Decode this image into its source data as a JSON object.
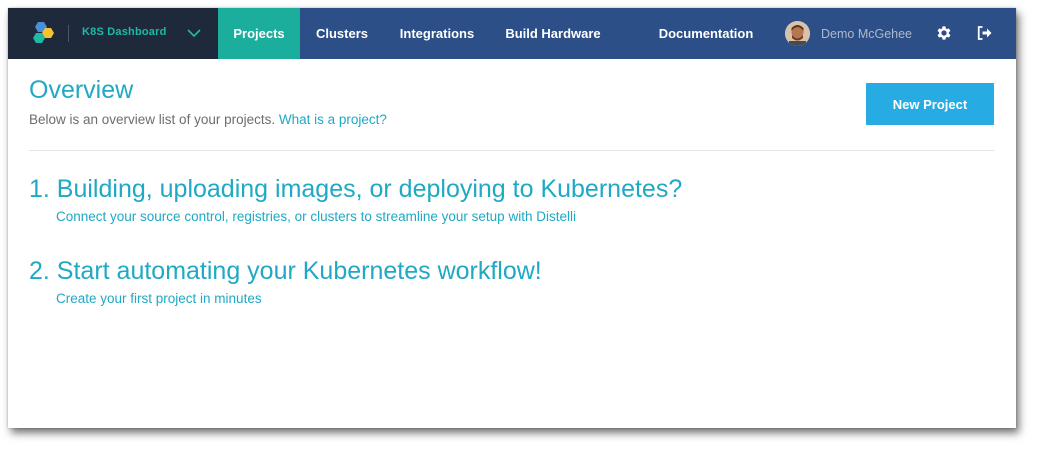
{
  "header": {
    "brand_name": "K8S Dashboard",
    "nav": [
      {
        "label": "Projects",
        "active": true
      },
      {
        "label": "Clusters",
        "active": false
      },
      {
        "label": "Integrations",
        "active": false
      },
      {
        "label": "Build Hardware",
        "active": false
      },
      {
        "label": "Documentation",
        "active": false
      }
    ],
    "user_name": "Demo McGehee",
    "icons": [
      "logo-icon",
      "chevron-down-icon",
      "avatar",
      "gear-icon",
      "logout-icon"
    ]
  },
  "overview": {
    "title": "Overview",
    "subtitle": "Below is an overview list of your projects.",
    "subtitle_link": "What is a project?",
    "new_project_label": "New Project"
  },
  "steps": [
    {
      "title": "1. Building, uploading images, or deploying to Kubernetes?",
      "subtitle": "Connect your source control, registries, or clusters to streamline your setup with Distelli"
    },
    {
      "title": "2. Start automating your Kubernetes workflow!",
      "subtitle": "Create your first project in minutes"
    }
  ],
  "colors": {
    "header_bg": "#2b4f86",
    "brand_bg": "#1e2a3c",
    "active_tab": "#1bae9c",
    "accent": "#1fa9c4",
    "button": "#26ace3"
  }
}
